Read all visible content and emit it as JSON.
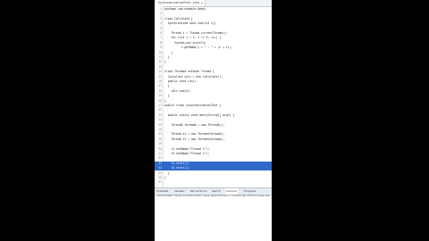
{
  "editor": {
    "tab_title": "SynchronizationTest.java ☒",
    "lines": [
      {
        "n": "1",
        "code": "package com.example.demo;",
        "selected": false
      },
      {
        "n": "2",
        "code": "",
        "selected": false
      },
      {
        "n": "3",
        "code": "class Calculate {",
        "selected": false
      },
      {
        "n": "4",
        "code": "  synchronized void sum(int n){",
        "selected": false
      },
      {
        "n": "5",
        "code": "",
        "selected": false
      },
      {
        "n": "6",
        "code": "    Thread t = Thread.currentThread();",
        "selected": false
      },
      {
        "n": "7",
        "code": "    for (int i = 1; i <= 5; i++) {",
        "selected": false
      },
      {
        "n": "8",
        "code": "      System.out.println(",
        "selected": false
      },
      {
        "n": "9",
        "code": "          t.getName() + \" : \" + (n + i));",
        "selected": false
      },
      {
        "n": "10",
        "code": "    }",
        "selected": false
      },
      {
        "n": "11",
        "code": "  }",
        "selected": false
      },
      {
        "n": "12",
        "code": "}",
        "selected": false
      },
      {
        "n": "13",
        "code": "",
        "selected": false
      },
      {
        "n": "14",
        "code": "class ThreadA extends Thread {",
        "selected": false
      },
      {
        "n": "15",
        "code": "  Calculate calc = new Calculate();",
        "selected": false
      },
      {
        "n": "16",
        "code": "  public void run()",
        "selected": false
      },
      {
        "n": "17",
        "code": "  {",
        "selected": false
      },
      {
        "n": "18",
        "code": "    calc.sum(4);",
        "selected": false
      },
      {
        "n": "19",
        "code": "  }",
        "selected": false
      },
      {
        "n": "20",
        "code": "}",
        "selected": false
      },
      {
        "n": "21",
        "code": "public class SynchronizationTest {",
        "selected": false
      },
      {
        "n": "22",
        "code": "",
        "selected": false
      },
      {
        "n": "23",
        "code": "  public static void main(String[] args) {",
        "selected": false
      },
      {
        "n": "24",
        "code": "",
        "selected": false
      },
      {
        "n": "25",
        "code": "    ThreadA threadA = new ThreadA();",
        "selected": false
      },
      {
        "n": "26",
        "code": "",
        "selected": false
      },
      {
        "n": "27",
        "code": "    Thread t1 = new Thread(threadA);",
        "selected": false
      },
      {
        "n": "28",
        "code": "    Thread t2 = new Thread(threadA);",
        "selected": false
      },
      {
        "n": "29",
        "code": "",
        "selected": false
      },
      {
        "n": "30",
        "code": "    t1.setName(\"Thread 1\");",
        "selected": false
      },
      {
        "n": "31",
        "code": "    t2.setName(\"Thread 2\");",
        "selected": false
      },
      {
        "n": "32",
        "code": "",
        "selected": false
      },
      {
        "n": "33",
        "code": "    t1.start();",
        "selected": true
      },
      {
        "n": "34",
        "code": "    t2.start();",
        "selected": true
      },
      {
        "n": "35",
        "code": "  }",
        "selected": false
      },
      {
        "n": "36",
        "code": "}",
        "selected": false
      },
      {
        "n": "37",
        "code": "",
        "selected": false
      }
    ]
  },
  "console": {
    "tabs": [
      "Problems",
      "Javadoc",
      "Declaration",
      "Search",
      "Console",
      "Progress"
    ],
    "status": "<terminated> SynchronizationTest [Java Application] C:\\Tools\\jdk-17\\bin\\javaw.exe"
  },
  "colors": {
    "selection": "#2f68c9",
    "background": "#000000"
  }
}
